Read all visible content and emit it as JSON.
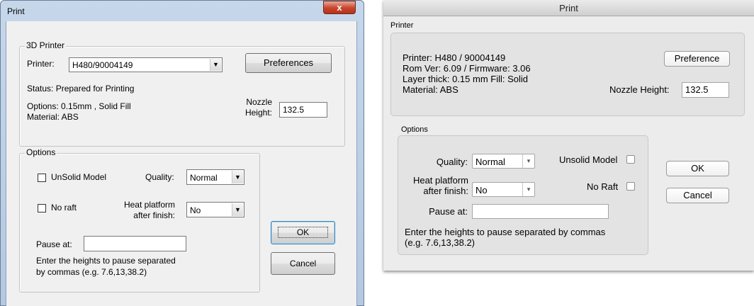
{
  "win": {
    "title": "Print",
    "close_glyph": "x",
    "printer_group": {
      "legend": "3D Printer",
      "printer_label": "Printer:",
      "printer_value": "H480/90004149",
      "preferences_button": "Preferences",
      "status": "Status: Prepared for Printing",
      "options_line": "Options: 0.15mm , Solid Fill",
      "material_line": "Material: ABS",
      "nozzle_label_1": "Nozzle",
      "nozzle_label_2": "Height:",
      "nozzle_value": "132.5"
    },
    "options_group": {
      "legend": "Options",
      "unsolid_label": "UnSolid Model",
      "unsolid_checked": false,
      "quality_label": "Quality:",
      "quality_value": "Normal",
      "noraft_label": "No raft",
      "noraft_checked": false,
      "heat_label_1": "Heat platform",
      "heat_label_2": "after finish:",
      "heat_value": "No",
      "pause_label": "Pause at:",
      "pause_value": "",
      "hint_1": "Enter the heights to pause separated",
      "hint_2": "by commas (e.g. 7.6,13,38.2)"
    },
    "ok_button": "OK",
    "cancel_button": "Cancel",
    "arrow_glyph": "▼"
  },
  "mac": {
    "title": "Print",
    "printer_section": {
      "label": "Printer",
      "printer_line": "Printer: H480 / 90004149",
      "rom_line": "Rom Ver: 6.09 / Firmware: 3.06",
      "layer_line": "Layer thick: 0.15 mm  Fill: Solid",
      "material_line": "Material: ABS",
      "preference_button": "Preference",
      "nozzle_label": "Nozzle Height:",
      "nozzle_value": "132.5"
    },
    "options_section": {
      "label": "Options",
      "quality_label": "Quality:",
      "quality_value": "Normal",
      "unsolid_label": "Unsolid Model",
      "unsolid_checked": false,
      "heat_label_1": "Heat platform",
      "heat_label_2": "after finish:",
      "heat_value": "No",
      "noraft_label": "No Raft",
      "noraft_checked": false,
      "pause_label": "Pause at:",
      "pause_value": "",
      "hint_1": "Enter the heights to pause separated by commas",
      "hint_2": "(e.g. 7.6,13,38.2)"
    },
    "ok_button": "OK",
    "cancel_button": "Cancel",
    "arrow_glyph": "▾"
  }
}
